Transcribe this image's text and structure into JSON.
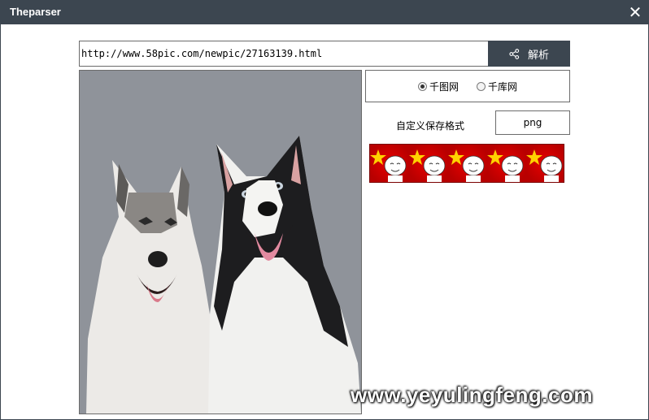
{
  "window": {
    "title": "Theparser"
  },
  "toolbar": {
    "url_value": "http://www.58pic.com/newpic/27163139.html",
    "parse_label": "解析"
  },
  "source": {
    "options": [
      {
        "label": "千图网",
        "selected": true
      },
      {
        "label": "千库网",
        "selected": false
      }
    ]
  },
  "format": {
    "label": "自定义保存格式",
    "value": "png"
  },
  "watermark": "www.yeyulingfeng.com",
  "colors": {
    "titlebar": "#3c4650",
    "banner": "#d40000",
    "photo_bg": "#8f939a"
  },
  "icons": {
    "close": "close-icon",
    "share": "share-icon"
  }
}
